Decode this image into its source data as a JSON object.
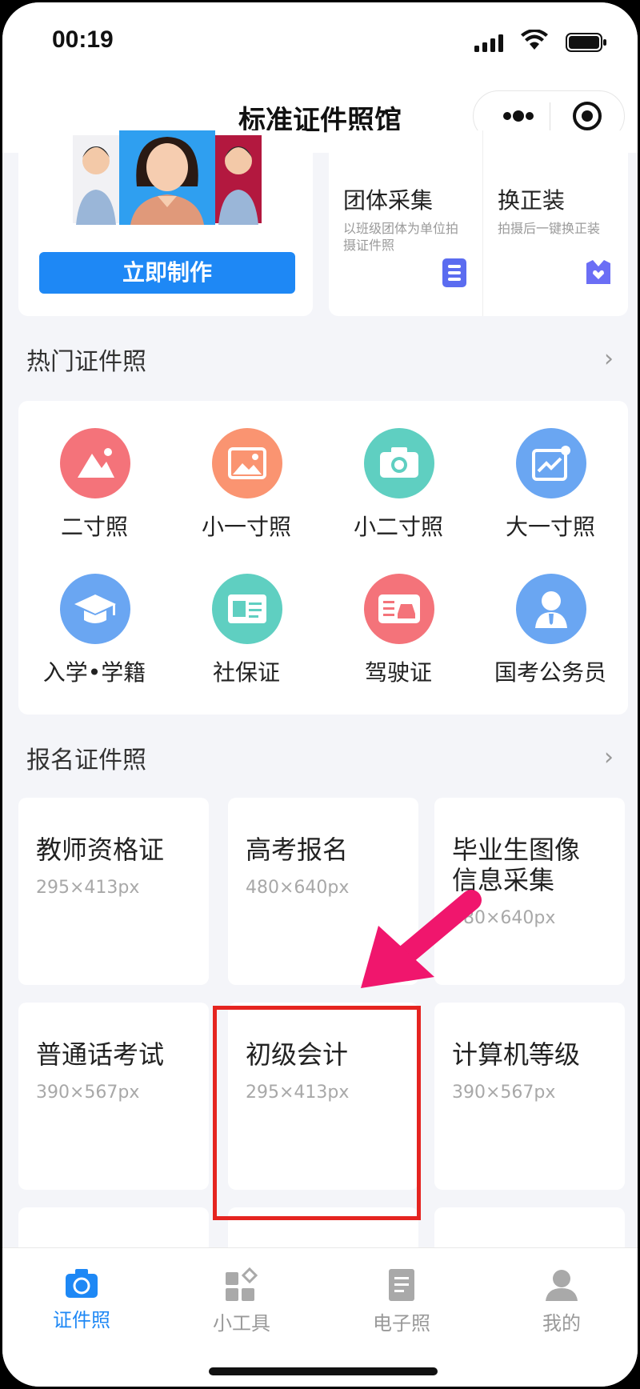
{
  "status": {
    "time": "00:19"
  },
  "nav": {
    "title": "标准证件照馆"
  },
  "hero": {
    "button_label": "立即制作"
  },
  "features": [
    {
      "title": "团体采集",
      "subtitle": "以班级团体为单位拍摄证件照",
      "icon": "list-icon",
      "color": "#5b6cf0"
    },
    {
      "title": "换正装",
      "subtitle": "拍摄后一键换正装",
      "icon": "suit-heart-icon",
      "color": "#6b6ef5"
    }
  ],
  "hot": {
    "title": "热门证件照",
    "items": [
      {
        "label": "二寸照",
        "icon": "mountain-icon",
        "color": "#f4737a"
      },
      {
        "label": "小一寸照",
        "icon": "picture-icon",
        "color": "#fa9471"
      },
      {
        "label": "小二寸照",
        "icon": "camera-icon",
        "color": "#5fcfc1"
      },
      {
        "label": "大一寸照",
        "icon": "chart-icon",
        "color": "#6aa6f2"
      },
      {
        "label": "入学•学籍",
        "icon": "graduation-cap-icon",
        "color": "#6aa6f2"
      },
      {
        "label": "社保证",
        "icon": "id-card-icon",
        "color": "#5fcfc1"
      },
      {
        "label": "驾驶证",
        "icon": "car-license-icon",
        "color": "#f4737a"
      },
      {
        "label": "国考公务员",
        "icon": "officer-icon",
        "color": "#6aa6f2"
      }
    ]
  },
  "registration": {
    "title": "报名证件照",
    "items": [
      {
        "title": "教师资格证",
        "size": "295×413px"
      },
      {
        "title": "高考报名",
        "size": "480×640px"
      },
      {
        "title": "毕业生图像信息采集",
        "size": "480×640px"
      },
      {
        "title": "普通话考试",
        "size": "390×567px"
      },
      {
        "title": "初级会计",
        "size": "295×413px"
      },
      {
        "title": "计算机等级",
        "size": "390×567px"
      }
    ]
  },
  "tabs": [
    {
      "label": "证件照",
      "icon": "camera-tab-icon",
      "active": true
    },
    {
      "label": "小工具",
      "icon": "tools-grid-icon",
      "active": false
    },
    {
      "label": "电子照",
      "icon": "document-icon",
      "active": false
    },
    {
      "label": "我的",
      "icon": "user-icon",
      "active": false
    }
  ],
  "colors": {
    "accent": "#1e88f5",
    "highlight": "#e52420",
    "arrow": "#f0166d"
  }
}
